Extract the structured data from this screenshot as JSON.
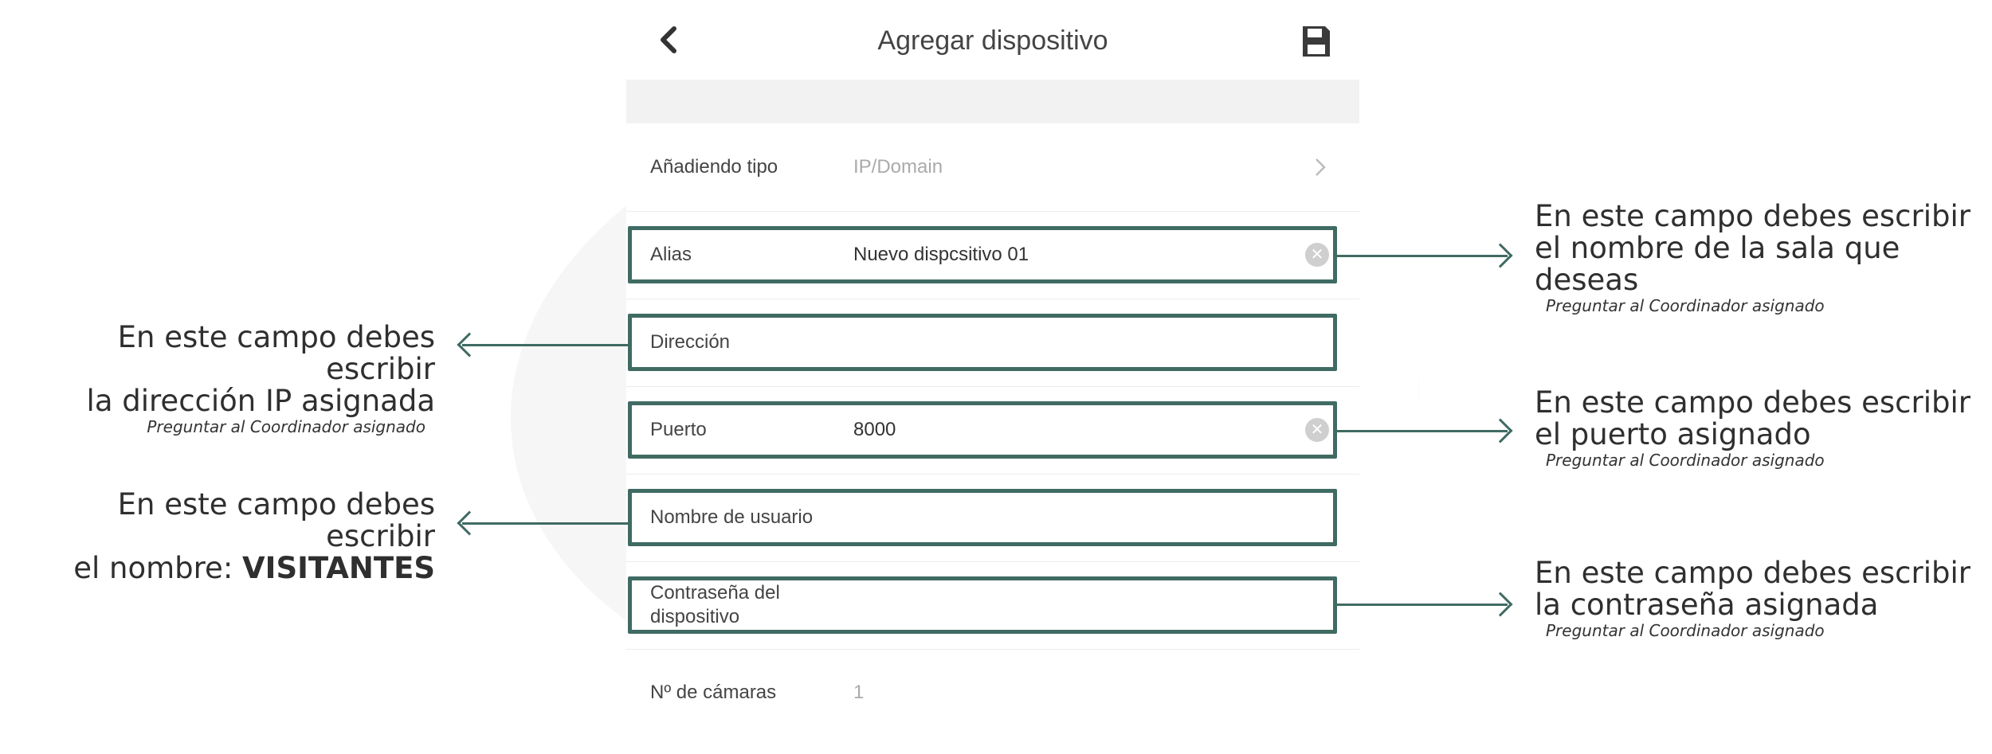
{
  "header": {
    "title": "Agregar dispositivo",
    "back_icon": "chevron-left-icon",
    "save_icon": "floppy-disk-icon"
  },
  "form": {
    "adding_type": {
      "label": "Añadiendo tipo",
      "value": "IP/Domain"
    },
    "alias": {
      "label": "Alias",
      "value": "Nuevo dispcsitivo 01"
    },
    "address": {
      "label": "Dirección",
      "value": ""
    },
    "port": {
      "label": "Puerto",
      "value": "8000"
    },
    "username": {
      "label": "Nombre de usuario",
      "value": ""
    },
    "password": {
      "label": "Contraseña del dispositivo",
      "value": ""
    },
    "cameras": {
      "label": "Nº de cámaras",
      "value": "1"
    }
  },
  "annotations": {
    "alias": {
      "line1": "En este campo debes escribir",
      "line2": "el nombre de la sala que deseas",
      "sub": "Preguntar al Coordinador asignado"
    },
    "address": {
      "line1": "En este campo debes escribir",
      "line2": "la dirección IP asignada",
      "sub": "Preguntar al Coordinador asignado"
    },
    "port": {
      "line1": "En este campo debes escribir",
      "line2": "el puerto asignado",
      "sub": "Preguntar al Coordinador asignado"
    },
    "username": {
      "line1": "En este campo debes escribir",
      "line2_prefix": "el nombre: ",
      "line2_bold": "VISITANTES"
    },
    "password": {
      "line1": "En este campo debes escribir",
      "line2": "la contraseña asignada",
      "sub": "Preguntar al Coordinador asignado"
    }
  },
  "colors": {
    "highlight": "#3f6b63",
    "band": "#f2f2f2",
    "muted_text": "#aaaaaa"
  }
}
